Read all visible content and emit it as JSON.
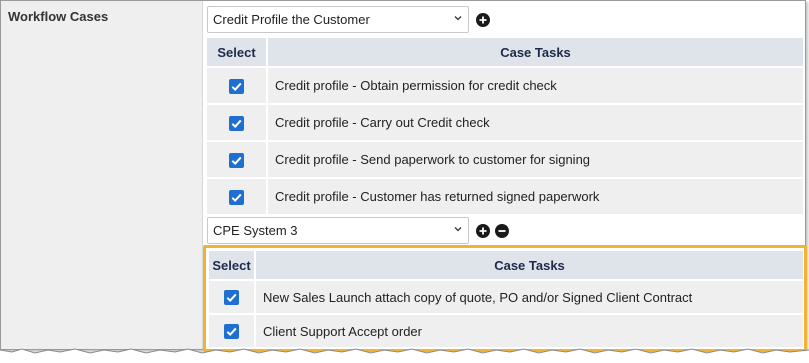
{
  "field": {
    "label": "Workflow Cases"
  },
  "workflows": [
    {
      "selected": "Credit Profile the Customer",
      "table": {
        "headers": [
          "Select",
          "Case Tasks"
        ],
        "rows": [
          {
            "checked": true,
            "task": "Credit profile - Obtain permission for credit check"
          },
          {
            "checked": true,
            "task": "Credit profile - Carry out Credit check"
          },
          {
            "checked": true,
            "task": "Credit profile - Send paperwork to customer for signing"
          },
          {
            "checked": true,
            "task": "Credit profile - Customer has returned signed paperwork"
          }
        ]
      },
      "buttons": [
        "add-icon"
      ]
    },
    {
      "selected": "CPE System 3",
      "table": {
        "headers": [
          "Select",
          "Case Tasks"
        ],
        "rows": [
          {
            "checked": true,
            "task": "New Sales Launch attach copy of quote, PO and/or Signed Client Contract"
          },
          {
            "checked": true,
            "task": "Client Support Accept order"
          }
        ]
      },
      "buttons": [
        "add-icon",
        "remove-icon"
      ]
    }
  ],
  "colors": {
    "checkbox": "#1f6fd1",
    "header_bg": "#dfe4ea",
    "row_bg": "#efefef",
    "highlight": "#f2b233"
  }
}
